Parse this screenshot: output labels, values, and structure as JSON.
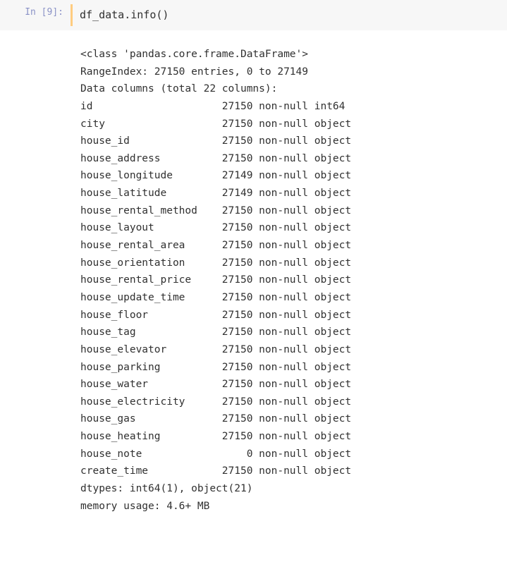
{
  "input": {
    "prompt": "In [9]:",
    "code": "df_data.info()"
  },
  "output": {
    "header_class": "<class 'pandas.core.frame.DataFrame'>",
    "range_index": "RangeIndex: 27150 entries, 0 to 27149",
    "columns_header": "Data columns (total 22 columns):",
    "columns": [
      {
        "name": "id",
        "count": "27150",
        "null": "non-null",
        "dtype": "int64"
      },
      {
        "name": "city",
        "count": "27150",
        "null": "non-null",
        "dtype": "object"
      },
      {
        "name": "house_id",
        "count": "27150",
        "null": "non-null",
        "dtype": "object"
      },
      {
        "name": "house_address",
        "count": "27150",
        "null": "non-null",
        "dtype": "object"
      },
      {
        "name": "house_longitude",
        "count": "27149",
        "null": "non-null",
        "dtype": "object"
      },
      {
        "name": "house_latitude",
        "count": "27149",
        "null": "non-null",
        "dtype": "object"
      },
      {
        "name": "house_rental_method",
        "count": "27150",
        "null": "non-null",
        "dtype": "object"
      },
      {
        "name": "house_layout",
        "count": "27150",
        "null": "non-null",
        "dtype": "object"
      },
      {
        "name": "house_rental_area",
        "count": "27150",
        "null": "non-null",
        "dtype": "object"
      },
      {
        "name": "house_orientation",
        "count": "27150",
        "null": "non-null",
        "dtype": "object"
      },
      {
        "name": "house_rental_price",
        "count": "27150",
        "null": "non-null",
        "dtype": "object"
      },
      {
        "name": "house_update_time",
        "count": "27150",
        "null": "non-null",
        "dtype": "object"
      },
      {
        "name": "house_floor",
        "count": "27150",
        "null": "non-null",
        "dtype": "object"
      },
      {
        "name": "house_tag",
        "count": "27150",
        "null": "non-null",
        "dtype": "object"
      },
      {
        "name": "house_elevator",
        "count": "27150",
        "null": "non-null",
        "dtype": "object"
      },
      {
        "name": "house_parking",
        "count": "27150",
        "null": "non-null",
        "dtype": "object"
      },
      {
        "name": "house_water",
        "count": "27150",
        "null": "non-null",
        "dtype": "object"
      },
      {
        "name": "house_electricity",
        "count": "27150",
        "null": "non-null",
        "dtype": "object"
      },
      {
        "name": "house_gas",
        "count": "27150",
        "null": "non-null",
        "dtype": "object"
      },
      {
        "name": "house_heating",
        "count": "27150",
        "null": "non-null",
        "dtype": "object"
      },
      {
        "name": "house_note",
        "count": "0",
        "null": "non-null",
        "dtype": "object"
      },
      {
        "name": "create_time",
        "count": "27150",
        "null": "non-null",
        "dtype": "object"
      }
    ],
    "dtypes_line": "dtypes: int64(1), object(21)",
    "memory_line": "memory usage: 4.6+ MB"
  }
}
